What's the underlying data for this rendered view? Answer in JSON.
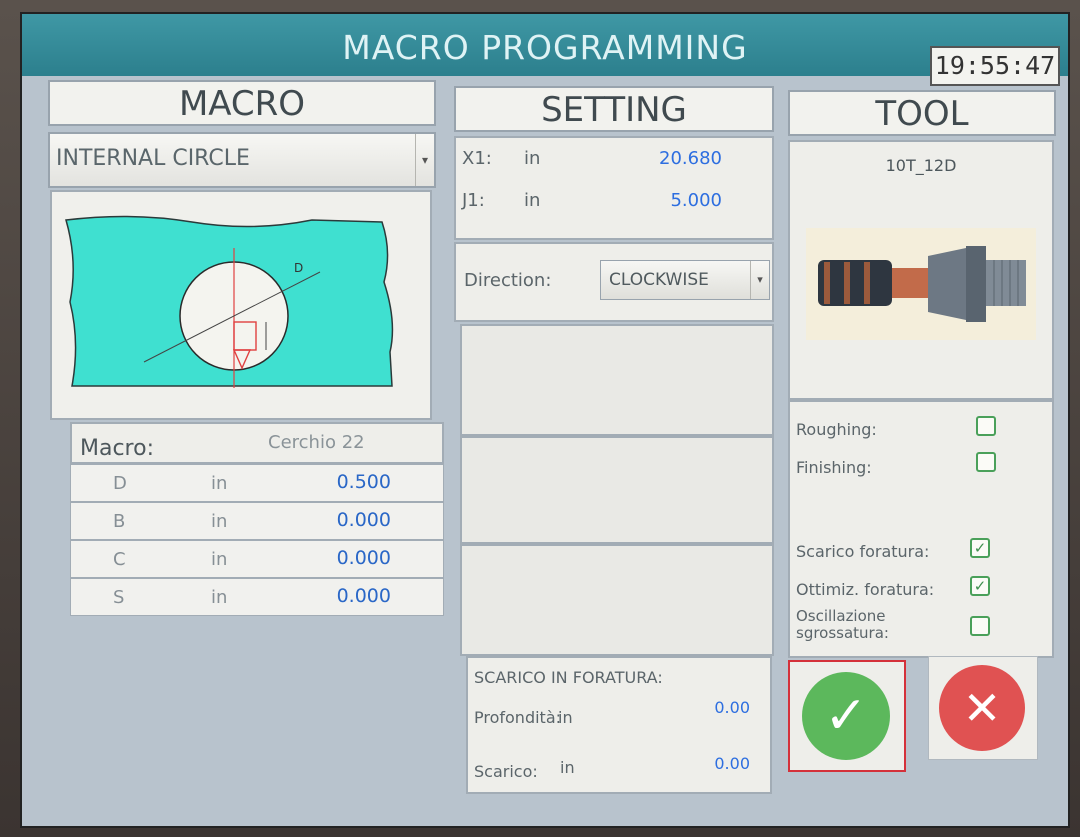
{
  "window": {
    "title": "MACRO PROGRAMMING",
    "clock": "19:55:47"
  },
  "headers": {
    "macro": "MACRO",
    "setting": "SETTING",
    "tool": "TOOL"
  },
  "macro": {
    "selected_type": "INTERNAL CIRCLE",
    "label": "Macro:",
    "name": "Cerchio 22",
    "params": [
      {
        "name": "D",
        "unit": "in",
        "value": "0.500"
      },
      {
        "name": "B",
        "unit": "in",
        "value": "0.000"
      },
      {
        "name": "C",
        "unit": "in",
        "value": "0.000"
      },
      {
        "name": "S",
        "unit": "in",
        "value": "0.000"
      }
    ],
    "diagram_label": "D"
  },
  "setting": {
    "coords": [
      {
        "name": "X1:",
        "unit": "in",
        "value": "20.680"
      },
      {
        "name": "J1:",
        "unit": "in",
        "value": "5.000"
      }
    ],
    "direction_label": "Direction:",
    "direction_value": "CLOCKWISE",
    "scarico_title": "SCARICO IN FORATURA:",
    "profondita_label": "Profondità:",
    "profondita_unit": "in",
    "profondita_value": "0.00",
    "scarico_label": "Scarico:",
    "scarico_unit": "in",
    "scarico_value": "0.00"
  },
  "tool": {
    "name": "10T_12D",
    "options": [
      {
        "label": "Roughing:",
        "checked": false
      },
      {
        "label": "Finishing:",
        "checked": false
      },
      {
        "label": "Scarico foratura:",
        "checked": true
      },
      {
        "label": "Ottimiz. foratura:",
        "checked": true
      },
      {
        "label": "Oscillazione sgrossatura:",
        "checked": false
      }
    ]
  },
  "icons": {
    "confirm": "check-icon",
    "cancel": "x-icon",
    "dropdown": "chevron-down-icon"
  },
  "colors": {
    "titlebar": "#2f8795",
    "value_blue": "#2d6ee0",
    "confirm_green": "#5cb85c",
    "cancel_red": "#e05252",
    "diagram_fill": "#3fe0d0"
  }
}
